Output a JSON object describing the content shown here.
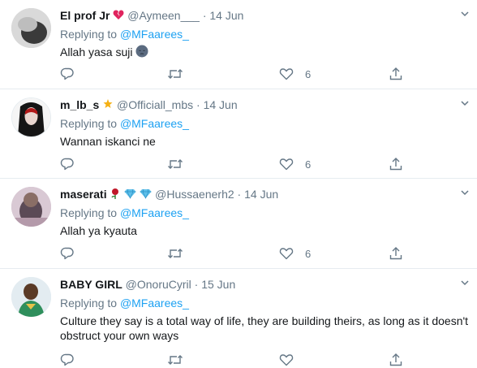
{
  "tweets": [
    {
      "name": "El prof Jr",
      "handle": "@Aymeen___",
      "separator": "·",
      "date": "14 Jun",
      "replying_label": "Replying to",
      "replying_to": "@MFaarees_",
      "text": "Allah yasa suji",
      "likes": "6"
    },
    {
      "name": "m_lb_s",
      "handle": "@Officiall_mbs",
      "separator": "·",
      "date": "14 Jun",
      "replying_label": "Replying to",
      "replying_to": "@MFaarees_",
      "text": "Wannan iskanci ne",
      "likes": "6"
    },
    {
      "name": "maserati",
      "handle": "@Hussaenerh2",
      "separator": "·",
      "date": "14 Jun",
      "replying_label": "Replying to",
      "replying_to": "@MFaarees_",
      "text": "Allah ya kyauta",
      "likes": "6"
    },
    {
      "name": "BABY GIRL",
      "handle": "@OnoruCyril",
      "separator": "·",
      "date": "15 Jun",
      "replying_label": "Replying to",
      "replying_to": "@MFaarees_",
      "text": "Culture they say is a total way of life, they are building theirs, as long as it doesn't obstruct your own ways"
    }
  ],
  "icons": {
    "reply": "reply-icon",
    "retweet": "retweet-icon",
    "like": "heart-icon",
    "share": "share-icon",
    "more": "chevron-down-icon"
  },
  "colors": {
    "link": "#1da1f2",
    "secondary_text": "#657786",
    "divider": "#e6ecf0"
  }
}
